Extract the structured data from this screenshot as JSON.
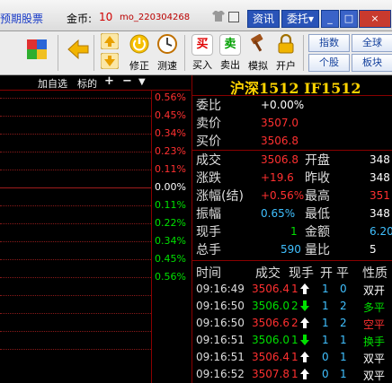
{
  "topbar": {
    "title": "预期股票",
    "coin_label": "金币:",
    "coin_value": "10",
    "username": "mo_220304268",
    "btn_zixun": "资讯",
    "btn_weituo": "委托▾"
  },
  "toolbar": {
    "tools": [
      "修正",
      "测速",
      "买入",
      "卖出",
      "模拟",
      "开户"
    ],
    "right_buttons": [
      "指数",
      "全球",
      "个股",
      "板块"
    ],
    "buy_icon": "买",
    "sell_icon": "卖"
  },
  "chart": {
    "header_tab1": "加自选",
    "header_tab2": "标的",
    "pct_labels": [
      "0.56%",
      "0.45%",
      "0.34%",
      "0.23%",
      "0.11%",
      "0.00%",
      "0.11%",
      "0.22%",
      "0.34%",
      "0.45%",
      "0.56%"
    ],
    "up_color": "#ff3030",
    "down_color": "#00e000"
  },
  "quote": {
    "title": "沪深1512 IF1512",
    "weibi_label": "委比",
    "weibi_value": "+0.00%",
    "ask_label": "卖价",
    "ask_value": "3507.0",
    "bid_label": "买价",
    "bid_value": "3506.8",
    "rows": [
      {
        "l1": "成交",
        "v1": "3506.8",
        "l2": "开盘",
        "v2": "348"
      },
      {
        "l1": "涨跌",
        "v1": "+19.6",
        "l2": "昨收",
        "v2": "348"
      },
      {
        "l1": "涨幅(结)",
        "v1": "+0.56%",
        "l2": "最高",
        "v2": "351"
      },
      {
        "l1": "振幅",
        "v1": "0.65%",
        "l2": "最低",
        "v2": "348"
      },
      {
        "l1": "现手",
        "v1": "1",
        "l2": "金额",
        "v2": "6.20"
      },
      {
        "l1": "总手",
        "v1": "590",
        "l2": "量比",
        "v2": "5"
      },
      {
        "l1": "",
        "v1": "",
        "l2": "",
        "v2": ""
      }
    ]
  },
  "trades": {
    "headers": [
      "时间",
      "成交",
      "现手",
      "开",
      "平",
      "性质"
    ],
    "rows": [
      {
        "time": "09:16:49",
        "price": "3506.4",
        "vol": "1",
        "dir": "up",
        "open": "1",
        "close": "0",
        "nature": "双开"
      },
      {
        "time": "09:16:50",
        "price": "3506.0",
        "vol": "2",
        "dir": "down",
        "open": "1",
        "close": "2",
        "nature": "多平"
      },
      {
        "time": "09:16:50",
        "price": "3506.6",
        "vol": "2",
        "dir": "up",
        "open": "1",
        "close": "2",
        "nature": "空平"
      },
      {
        "time": "09:16:51",
        "price": "3506.0",
        "vol": "1",
        "dir": "down",
        "open": "1",
        "close": "1",
        "nature": "换手"
      },
      {
        "time": "09:16:51",
        "price": "3506.4",
        "vol": "1",
        "dir": "up",
        "open": "0",
        "close": "1",
        "nature": "双平"
      },
      {
        "time": "09:16:52",
        "price": "3507.8",
        "vol": "1",
        "dir": "up",
        "open": "0",
        "close": "1",
        "nature": "双平"
      }
    ]
  }
}
